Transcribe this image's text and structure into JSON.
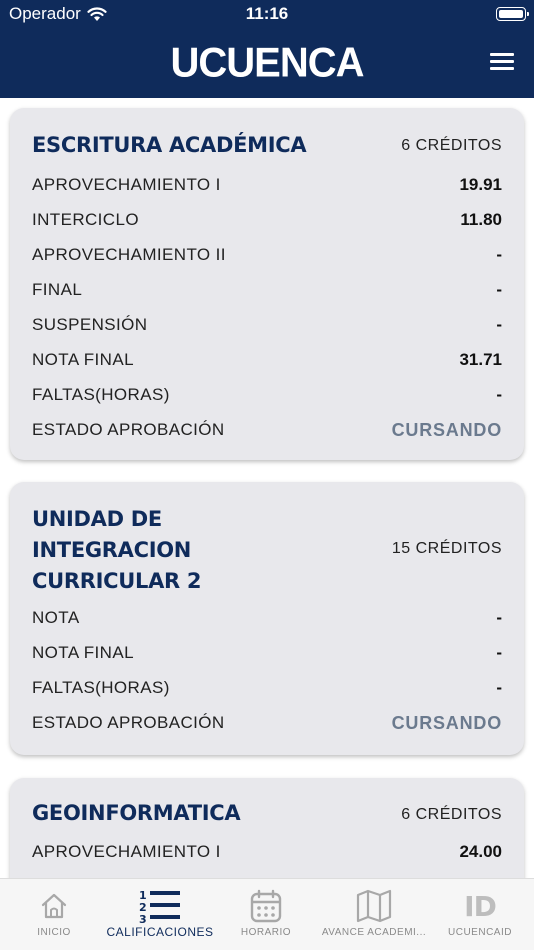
{
  "status_bar": {
    "carrier": "Operador",
    "time": "11:16"
  },
  "header": {
    "logo": "UCUENCA"
  },
  "cards": [
    {
      "title": "ESCRITURA ACADÉMICA",
      "credits": "6 CRÉDITOS",
      "rows": [
        {
          "label": "APROVECHAMIENTO I",
          "value": "19.91"
        },
        {
          "label": "INTERCICLO",
          "value": "11.80"
        },
        {
          "label": "APROVECHAMIENTO II",
          "value": "-"
        },
        {
          "label": "FINAL",
          "value": "-"
        },
        {
          "label": "SUSPENSIÓN",
          "value": "-"
        },
        {
          "label": "NOTA FINAL",
          "value": "31.71"
        },
        {
          "label": "FALTAS(HORAS)",
          "value": "-"
        },
        {
          "label": "ESTADO APROBACIÓN",
          "value": "CURSANDO"
        }
      ]
    },
    {
      "title_lines": [
        "UNIDAD DE",
        "INTEGRACION",
        "CURRICULAR 2"
      ],
      "credits": "15 CRÉDITOS",
      "rows": [
        {
          "label": "NOTA",
          "value": "-"
        },
        {
          "label": "NOTA FINAL",
          "value": "-"
        },
        {
          "label": "FALTAS(HORAS)",
          "value": "-"
        },
        {
          "label": "ESTADO APROBACIÓN",
          "value": "CURSANDO"
        }
      ]
    },
    {
      "title": "GEOINFORMATICA",
      "credits": "6 CRÉDITOS",
      "rows": [
        {
          "label": "APROVECHAMIENTO I",
          "value": "24.00"
        }
      ]
    }
  ],
  "tabbar": [
    {
      "label": "INICIO",
      "icon": "home-icon"
    },
    {
      "label": "CALIFICACIONES",
      "icon": "numbered-list-icon"
    },
    {
      "label": "HORARIO",
      "icon": "calendar-icon"
    },
    {
      "label": "AVANCE ACADEMI...",
      "icon": "map-icon"
    },
    {
      "label": "UCUENCAID",
      "icon": "id-icon"
    }
  ],
  "colors": {
    "primary": "#0f2b5b",
    "status": "#6b7a8e",
    "card": "#e8e8ec",
    "inactive": "#8a8a8a"
  }
}
